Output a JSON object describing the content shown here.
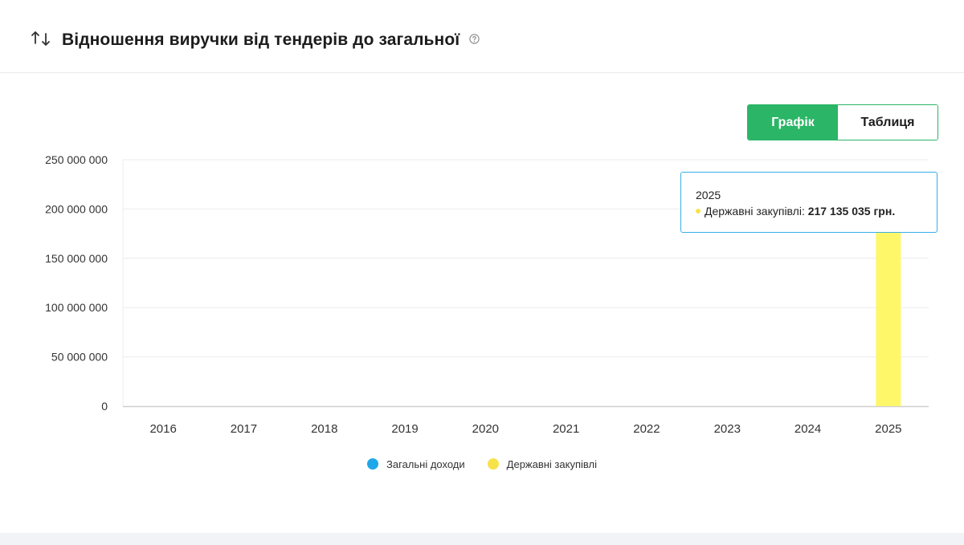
{
  "header": {
    "title": "Відношення виручки від тендерів до загальної",
    "sort_icon": "sort-arrows-icon",
    "help_icon": "question-circle-icon"
  },
  "view_toggle": {
    "chart_label": "Графік",
    "table_label": "Таблиця",
    "active": "chart",
    "accent_color": "#2bb566"
  },
  "tooltip": {
    "year": "2025",
    "series_label": "Державні закупівлі:",
    "value": "217 135 035 грн.",
    "border_color": "#37aee8"
  },
  "chart_data": {
    "type": "bar",
    "categories": [
      "2016",
      "2017",
      "2018",
      "2019",
      "2020",
      "2021",
      "2022",
      "2023",
      "2024",
      "2025"
    ],
    "series": [
      {
        "name": "Загальні доходи",
        "color": "#1fa7ea",
        "values": [
          0,
          0,
          0,
          0,
          0,
          0,
          0,
          0,
          0,
          0
        ]
      },
      {
        "name": "Державні закупівлі",
        "color": "#fff76a",
        "legend_color": "#f7e24a",
        "values": [
          0,
          0,
          0,
          0,
          0,
          0,
          0,
          0,
          0,
          217135035
        ]
      }
    ],
    "y_ticks": [
      "0",
      "50 000 000",
      "100 000 000",
      "150 000 000",
      "200 000 000",
      "250 000 000"
    ],
    "ylim": [
      0,
      250000000
    ],
    "grid": true,
    "legend_position": "bottom"
  }
}
